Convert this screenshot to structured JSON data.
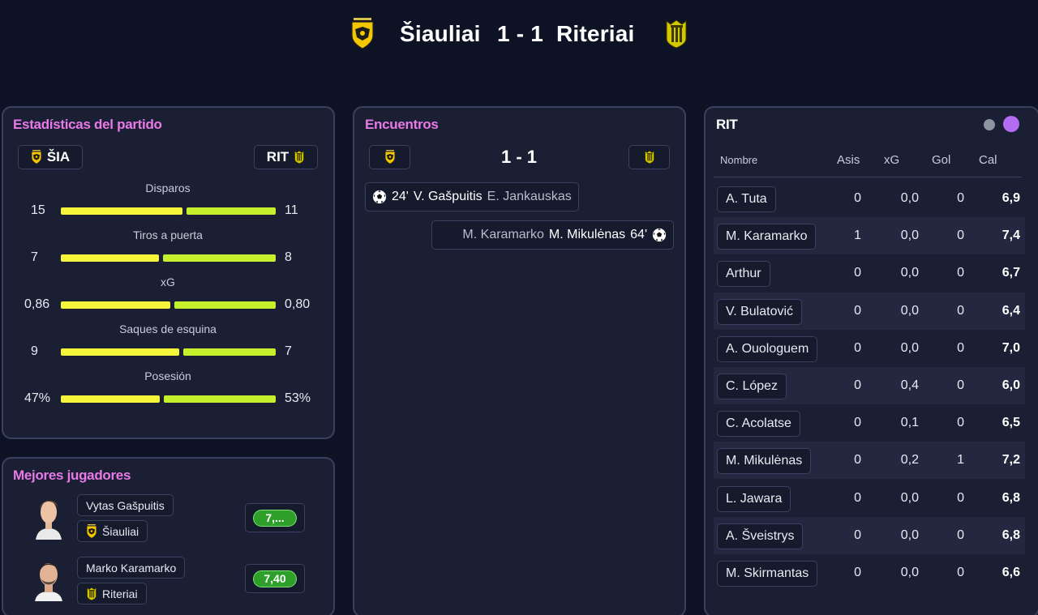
{
  "match": {
    "home_team": "Šiauliai",
    "score": "1 - 1",
    "away_team": "Riteriai"
  },
  "stats_panel": {
    "title": "Estadísticas del partido",
    "home_abbr": "ŠIA",
    "away_abbr": "RIT",
    "rows": [
      {
        "label": "Disparos",
        "home": "15",
        "away": "11",
        "home_share": 0.577
      },
      {
        "label": "Tiros a puerta",
        "home": "7",
        "away": "8",
        "home_share": 0.467
      },
      {
        "label": "xG",
        "home": "0,86",
        "away": "0,80",
        "home_share": 0.518
      },
      {
        "label": "Saques de esquina",
        "home": "9",
        "away": "7",
        "home_share": 0.563
      },
      {
        "label": "Posesión",
        "home": "47%",
        "away": "53%",
        "home_share": 0.47
      }
    ]
  },
  "best_players": {
    "title": "Mejores jugadores",
    "players": [
      {
        "name": "Vytas Gašpuitis",
        "team": "Šiauliai",
        "rating": "7,..."
      },
      {
        "name": "Marko Karamarko",
        "team": "Riteriai",
        "rating": "7,40"
      }
    ]
  },
  "events_panel": {
    "title": "Encuentros",
    "score": "1 - 1",
    "events": [
      {
        "minute": "24'",
        "scorer": "V. Gašpuitis",
        "assist": "E. Jankauskas",
        "side": "home"
      },
      {
        "minute": "64'",
        "scorer": "M. Mikulėnas",
        "assist": "M. Karamarko",
        "side": "away"
      }
    ]
  },
  "lineup_panel": {
    "title": "RIT",
    "columns": {
      "name": "Nombre",
      "assists": "Asis",
      "xg": "xG",
      "goals": "Gol",
      "rating": "Cal"
    },
    "players": [
      {
        "name": "A. Tuta",
        "assists": "0",
        "xg": "0,0",
        "goals": "0",
        "rating": "6,9"
      },
      {
        "name": "M. Karamarko",
        "assists": "1",
        "xg": "0,0",
        "goals": "0",
        "rating": "7,4"
      },
      {
        "name": "Arthur",
        "assists": "0",
        "xg": "0,0",
        "goals": "0",
        "rating": "6,7"
      },
      {
        "name": "V. Bulatović",
        "assists": "0",
        "xg": "0,0",
        "goals": "0",
        "rating": "6,4"
      },
      {
        "name": "A. Ouologuem",
        "assists": "0",
        "xg": "0,0",
        "goals": "0",
        "rating": "7,0"
      },
      {
        "name": "C. López",
        "assists": "0",
        "xg": "0,4",
        "goals": "0",
        "rating": "6,0"
      },
      {
        "name": "C. Acolatse",
        "assists": "0",
        "xg": "0,1",
        "goals": "0",
        "rating": "6,5"
      },
      {
        "name": "M. Mikulėnas",
        "assists": "0",
        "xg": "0,2",
        "goals": "1",
        "rating": "7,2"
      },
      {
        "name": "L. Jawara",
        "assists": "0",
        "xg": "0,0",
        "goals": "0",
        "rating": "6,8"
      },
      {
        "name": "A. Šveistrys",
        "assists": "0",
        "xg": "0,0",
        "goals": "0",
        "rating": "6,8"
      },
      {
        "name": "M. Skirmantas",
        "assists": "0",
        "xg": "0,0",
        "goals": "0",
        "rating": "6,6"
      }
    ]
  },
  "colors": {
    "background": "#0d1324",
    "panel": "#1a1f33",
    "accent_pink": "#e87ae8",
    "home_bar": "#f5f53a",
    "away_bar": "#c6ef2c",
    "rating_green": "#2ea02a",
    "toggle_active": "#b36cf2"
  }
}
